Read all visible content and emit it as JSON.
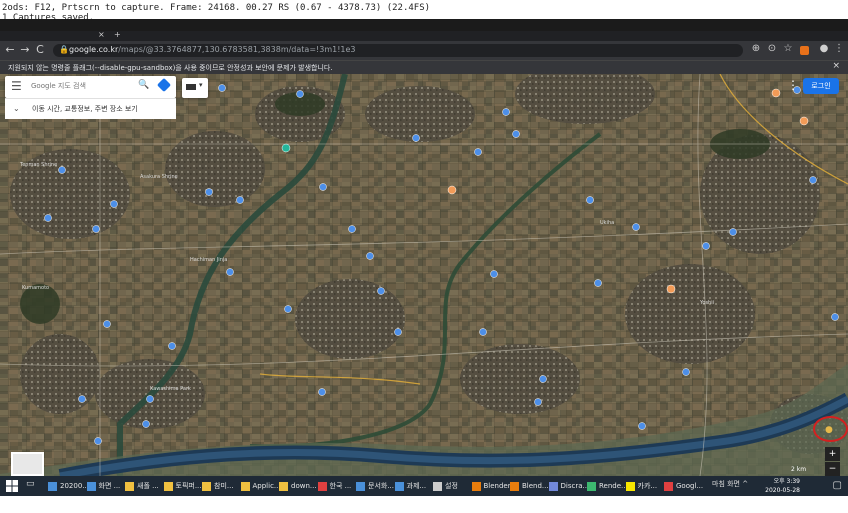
{
  "overlay": {
    "line1": "2ods: F12, Prtscrn to capture. Frame: 24168. 00.27 RS (0.67 - 4378.73) (22.4FS)",
    "line2": "1 Captures saved."
  },
  "browser": {
    "url_host": "google.co.kr",
    "url_rest": "/maps/@33.3764877,130.6783581,3838m/data=!3m1!1e3",
    "info_bar": "지원되지 않는 명령줄 플래그(--disable-gpu-sandbox)을 사용 중이므로 안정성과 보안에 문제가 발생합니다.",
    "info_close": "×",
    "nav": {
      "back": "←",
      "forward": "→",
      "reload": "C"
    }
  },
  "maps": {
    "search_placeholder": "Google 지도 검색",
    "nearby_label": "이동 시간, 교통정보, 주변 장소 보기",
    "signin_label": "로그인",
    "scale": "2 km",
    "zoom_in": "+",
    "zoom_out": "−",
    "place_labels": [
      "Kawashima Park",
      "Asakura Shrine",
      "Hachiman Jinja",
      "Ukiha",
      "Tenman Shrine",
      "Kumamoto",
      "Yoshii"
    ]
  },
  "taskbar": {
    "items": [
      {
        "label": "20200...",
        "color": "#4a90d9"
      },
      {
        "label": "화면 ...",
        "color": "#4a90d9"
      },
      {
        "label": "새폴 ...",
        "color": "#f0c040"
      },
      {
        "label": "토픽퍼...",
        "color": "#f0c040"
      },
      {
        "label": "참미...",
        "color": "#f0c040"
      },
      {
        "label": "Applic...",
        "color": "#f0c040"
      },
      {
        "label": "down...",
        "color": "#f0c040"
      },
      {
        "label": "한국 ...",
        "color": "#e04040"
      },
      {
        "label": "문서화...",
        "color": "#4a90d9"
      },
      {
        "label": "과제...",
        "color": "#4a90d9"
      },
      {
        "label": "설정",
        "color": "#cccccc"
      },
      {
        "label": "Blender",
        "color": "#e87d0d"
      },
      {
        "label": "Blend...",
        "color": "#e87d0d"
      },
      {
        "label": "Discra...",
        "color": "#7289da"
      },
      {
        "label": "Rende...",
        "color": "#3db870"
      },
      {
        "label": "카카...",
        "color": "#f7e600"
      },
      {
        "label": "Googl...",
        "color": "#e04040"
      }
    ],
    "tray_text": "마침 화면 ^",
    "time": "오후 3:39",
    "date": "2020-05-28"
  },
  "colors": {
    "accent": "#1a73e8",
    "taskbar": "#1f2a36",
    "chrome_dark": "#35363a",
    "annotation": "#d42020"
  }
}
